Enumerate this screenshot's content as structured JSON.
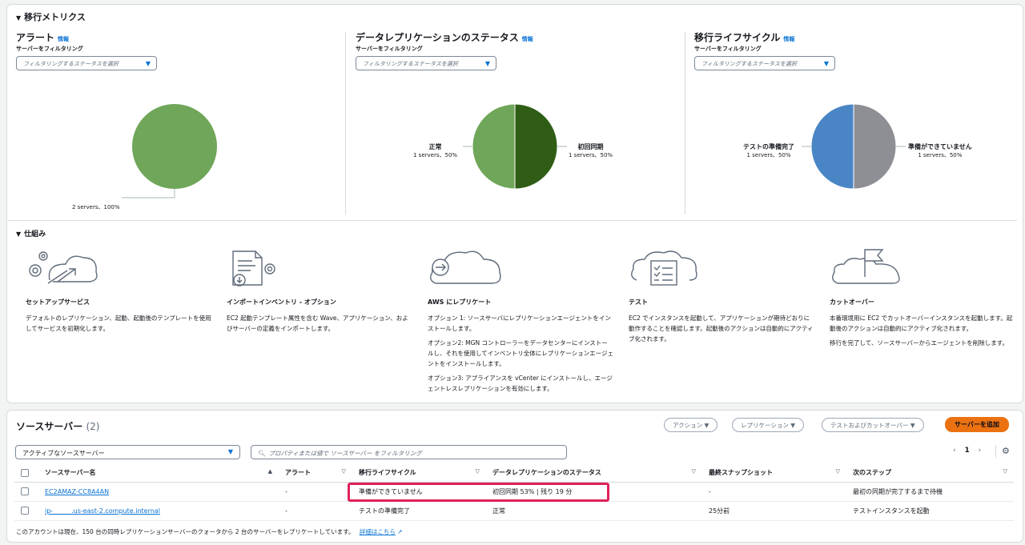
{
  "metrics": {
    "title": "移行メトリクス",
    "panels": [
      {
        "title": "アラート",
        "info": "情報",
        "filter_label": "サーバーをフィルタリング",
        "dropdown_placeholder": "フィルタリングするステータスを選択",
        "slices": [
          {
            "label": "",
            "value": "2 servers、100%",
            "pct": 100,
            "color": "#6fa659"
          }
        ]
      },
      {
        "title": "データレプリケーションのステータス",
        "info": "情報",
        "filter_label": "サーバーをフィルタリング",
        "dropdown_placeholder": "フィルタリングするステータスを選択",
        "slices": [
          {
            "label": "正常",
            "value": "1 servers、50%",
            "pct": 50,
            "color": "#6fa659"
          },
          {
            "label": "初回同期",
            "value": "1 servers、50%",
            "pct": 50,
            "color": "#2f5d16"
          }
        ]
      },
      {
        "title": "移行ライフサイクル",
        "info": "情報",
        "filter_label": "サーバーをフィルタリング",
        "dropdown_placeholder": "フィルタリングするステータスを選択",
        "slices": [
          {
            "label": "テストの準備完了",
            "value": "1 servers、50%",
            "pct": 50,
            "color": "#4a86c5"
          },
          {
            "label": "準備ができていません",
            "value": "1 servers、50%",
            "pct": 50,
            "color": "#8e8f95"
          }
        ]
      }
    ]
  },
  "how": {
    "title": "仕組み",
    "steps": [
      {
        "title": "セットアップサービス",
        "desc": [
          "デフォルトのレプリケーション、起動、起動後のテンプレートを使用してサービスを初期化します。"
        ],
        "icon": "setup-gears-cloud-icon"
      },
      {
        "title": "インポートインベントリ - オプション",
        "desc": [
          "EC2 起動テンプレート属性を含む Wave、アプリケーション、およびサーバーの定義をインポートします。"
        ],
        "icon": "import-document-icon"
      },
      {
        "title": "AWS にレプリケート",
        "desc": [
          "オプション 1: ソースサーバにレプリケーションエージェントをインストールします。",
          "オプション2: MGN コントローラーをデータセンターにインストールし、それを使用してインベントリ全体にレプリケーションエージェントをインストールします。",
          "オプション3: アプライアンスを vCenter にインストールし、エージェントレスレプリケーションを有効にします。"
        ],
        "icon": "replicate-cloud-icon"
      },
      {
        "title": "テスト",
        "desc": [
          "EC2 でインスタンスを起動して、アプリケーションが期待どおりに動作することを確認します。起動後のアクションは自動的にアクティブ化されます。"
        ],
        "icon": "test-checklist-cloud-icon"
      },
      {
        "title": "カットオーバー",
        "desc": [
          "本番環境用に EC2 でカットオーバーインスタンスを起動します。起動後のアクションは自動的にアクティブ化されます。",
          "移行を完了して、ソースサーバーからエージェントを削除します。"
        ],
        "icon": "cutover-flag-cloud-icon"
      }
    ]
  },
  "servers": {
    "title": "ソースサーバー",
    "count": "(2)",
    "actions_label": "アクション",
    "replication_label": "レプリケーション",
    "test_cutover_label": "テストおよびカットオーバー",
    "add_server_label": "サーバーを追加",
    "filter_select": "アクティブなソースサーバー",
    "search_placeholder": "プロパティまたは値で ソースサーバー をフィルタリング",
    "page": "1",
    "columns": [
      "ソースサーバー名",
      "アラート",
      "移行ライフサイクル",
      "データレプリケーションのステータス",
      "最終スナップショット",
      "次のステップ"
    ],
    "rows": [
      {
        "name": "EC2AMAZ-CC8A4AN",
        "alert": "-",
        "lifecycle": "準備ができていません",
        "replication": "初回同期 53% | 残り 19 分",
        "snapshot": "-",
        "next": "最初の同期が完了するまで待機"
      },
      {
        "name": "ip-         .us-east-2.compute.internal",
        "alert": "-",
        "lifecycle": "テストの準備完了",
        "replication": "正常",
        "snapshot": "25分前",
        "next": "テストインスタンスを起動"
      }
    ],
    "footer_text": "このアカウントは現在、150 台の同時レプリケーションサーバーのクォータから 2 台のサーバーをレプリケートしています。",
    "footer_link": "詳細はこちら"
  }
}
